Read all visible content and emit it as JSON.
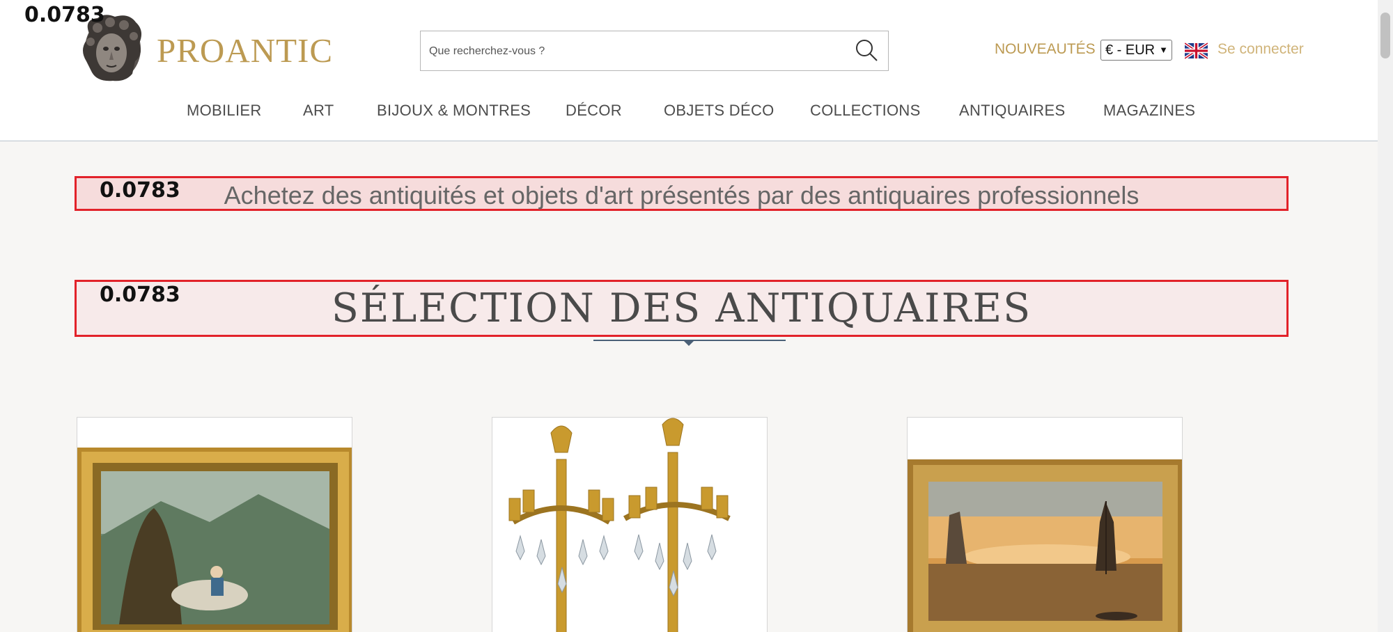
{
  "header": {
    "brand": "PROANTIC",
    "search_placeholder": "Que recherchez-vous ?",
    "nouveautes": "NOUVEAUTÉS",
    "currency": "€ - EUR",
    "login": "Se connecter"
  },
  "nav": {
    "items": [
      {
        "label": "MOBILIER"
      },
      {
        "label": "ART"
      },
      {
        "label": "BIJOUX & MONTRES"
      },
      {
        "label": "DÉCOR"
      },
      {
        "label": "OBJETS DÉCO"
      },
      {
        "label": "COLLECTIONS"
      },
      {
        "label": "ANTIQUAIRES"
      },
      {
        "label": "MAGAZINES"
      }
    ]
  },
  "markers": {
    "top": "0.0783",
    "tagline": "0.0783",
    "section": "0.0783"
  },
  "main": {
    "tagline": "Achetez des antiquités et objets d'art présentés par des antiquaires professionnels",
    "section_title": "SÉLECTION DES ANTIQUAIRES"
  },
  "colors": {
    "brand": "#bc9a52",
    "highlight_border": "#e2222a"
  }
}
